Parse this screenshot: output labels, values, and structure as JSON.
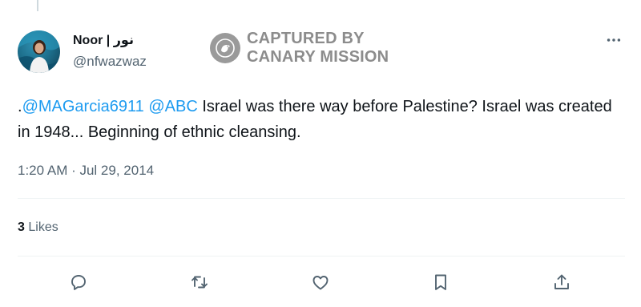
{
  "author": {
    "display_name": "Noor | نور",
    "handle": "@nfwazwaz"
  },
  "watermark": {
    "line1": "CAPTURED BY",
    "line2": "CANARY MISSION"
  },
  "tweet": {
    "prefix": ".",
    "mention_1": "@MAGarcia6911",
    "mention_2": "@ABC",
    "body": " Israel was there way before Palestine? Israel was created in 1948... Beginning of ethnic cleansing.",
    "timestamp": "1:20 AM · Jul 29, 2014"
  },
  "stats": {
    "likes_count": "3",
    "likes_label": "Likes"
  },
  "icons": {
    "more": "more-horizontal-icon",
    "reply": "reply-icon",
    "retweet": "retweet-icon",
    "like": "like-icon",
    "bookmark": "bookmark-icon",
    "share": "share-icon"
  },
  "colors": {
    "link": "#1d9bf0",
    "secondary_text": "#536471",
    "watermark": "#8c8c8c"
  }
}
